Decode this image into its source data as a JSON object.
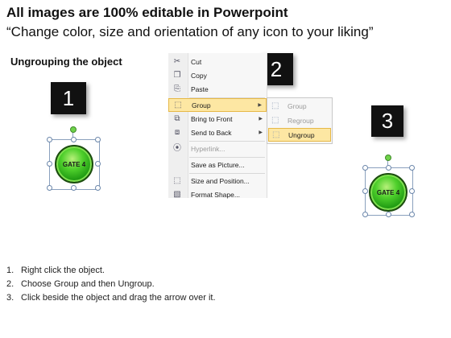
{
  "header": {
    "title": "All images are 100% editable in Powerpoint",
    "subtitle": "“Change color, size and orientation of any icon to your liking”"
  },
  "section_heading": "Ungrouping the object",
  "step_badges": [
    "1",
    "2",
    "3"
  ],
  "shape_label": "GATE 4",
  "context_menu": {
    "items": [
      {
        "label": "Cut",
        "icon": "scissors-icon",
        "glyph": "✂"
      },
      {
        "label": "Copy",
        "icon": "copy-icon",
        "glyph": "❐"
      },
      {
        "label": "Paste",
        "icon": "paste-icon",
        "glyph": "⎘"
      },
      {
        "label": "Group",
        "icon": "group-icon",
        "glyph": "⬚",
        "submenu_arrow": "▶",
        "highlighted": true
      },
      {
        "label": "Bring to Front",
        "icon": "bring-to-front-icon",
        "glyph": "⧉",
        "submenu_arrow": "▶"
      },
      {
        "label": "Send to Back",
        "icon": "send-to-back-icon",
        "glyph": "⧈",
        "submenu_arrow": "▶"
      },
      {
        "label": "Hyperlink...",
        "icon": "hyperlink-icon",
        "glyph": "⦿",
        "disabled": true
      },
      {
        "label": "Save as Picture...",
        "icon": "",
        "glyph": ""
      },
      {
        "label": "Size and Position...",
        "icon": "size-position-icon",
        "glyph": "⬚"
      },
      {
        "label": "Format Shape...",
        "icon": "format-shape-icon",
        "glyph": "▧"
      }
    ]
  },
  "submenu": {
    "items": [
      {
        "label": "Group",
        "icon": "group-icon",
        "glyph": "⬚",
        "disabled": true
      },
      {
        "label": "Regroup",
        "icon": "regroup-icon",
        "glyph": "⬚",
        "disabled": true
      },
      {
        "label": "Ungroup",
        "icon": "ungroup-icon",
        "glyph": "⬚",
        "highlighted": true
      }
    ]
  },
  "steps": [
    {
      "num": "1.",
      "text": "Right click the object."
    },
    {
      "num": "2.",
      "text": "Choose Group and then Ungroup."
    },
    {
      "num": "3.",
      "text": "Click beside the object and drag the arrow over it."
    }
  ],
  "colors": {
    "badge_bg": "#111111",
    "menu_highlight": "#fde7a3",
    "gate_green": "#3cc21e"
  }
}
